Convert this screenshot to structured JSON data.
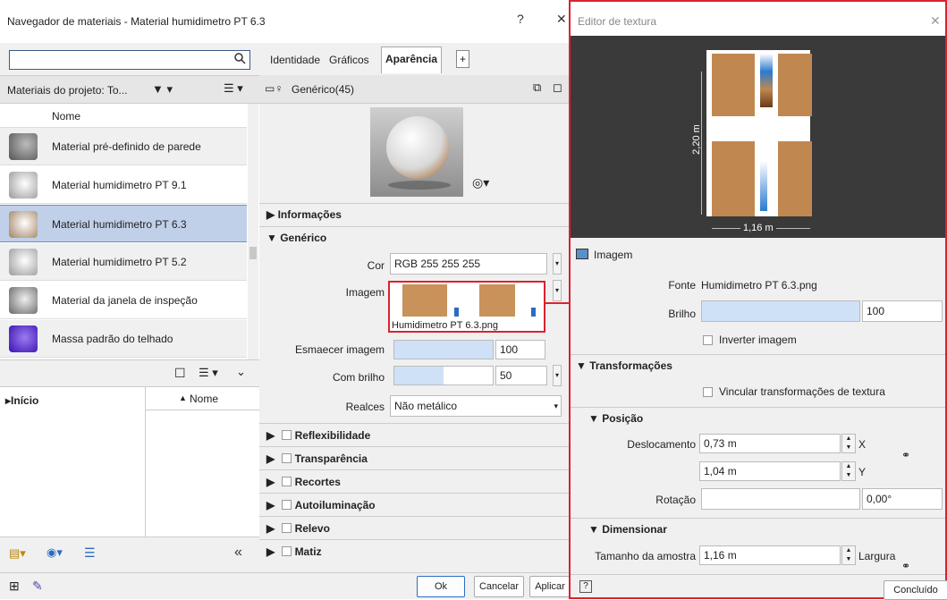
{
  "browser": {
    "title": "Navegador de materiais - Material humidimetro PT 6.3",
    "help": "?",
    "close": "✕",
    "search": {
      "value": "",
      "placeholder": ""
    },
    "filter_label": "Materiais do projeto: To...",
    "column_header": "Nome",
    "materials": [
      {
        "label": "Material pré-definido de parede"
      },
      {
        "label": "Material humidimetro PT 9.1"
      },
      {
        "label": "Material humidimetro PT 6.3"
      },
      {
        "label": "Material humidimetro PT 5.2"
      },
      {
        "label": "Material da janela de inspeção"
      },
      {
        "label": "Massa padrão do telhado"
      }
    ],
    "tree_root": "▸Início",
    "tree_column": "Nome",
    "collapse": "«"
  },
  "tabs": [
    "Identidade",
    "Gráficos",
    "Aparência",
    "+"
  ],
  "asset": {
    "name": "Genérico(45)"
  },
  "sections": {
    "informacoes": "Informações",
    "generico": "Genérico",
    "reflexibilidade": "Reflexibilidade",
    "transparencia": "Transparência",
    "recortes": "Recortes",
    "autoiluminacao": "Autoiluminação",
    "relevo": "Relevo",
    "matiz": "Matiz"
  },
  "generic": {
    "cor_label": "Cor",
    "cor_value": "RGB 255 255 255",
    "imagem_label": "Imagem",
    "imagem_file": "Humidimetro PT 6.3.png",
    "esmaecer_label": "Esmaecer imagem",
    "esmaecer_value": "100",
    "esmaecer_level": 1.0,
    "brilho_label": "Com brilho",
    "brilho_value": "50",
    "brilho_level": 0.5,
    "realces_label": "Realces",
    "realces_value": "Não metálico"
  },
  "buttons": {
    "ok": "Ok",
    "cancel": "Cancelar",
    "apply": "Aplicar"
  },
  "editor": {
    "title": "Editor de textura",
    "close": "✕",
    "dim_height": "2,20 m",
    "dim_width": "1,16 m",
    "imagem_header": "Imagem",
    "fonte_label": "Fonte",
    "fonte_value": "Humidimetro PT 6.3.png",
    "brilho_label": "Brilho",
    "brilho_value": "100",
    "brilho_level": 1.0,
    "inverter_label": "Inverter imagem",
    "transformacoes": "Transformações",
    "vincular_label": "Vincular transformações de textura",
    "posicao": "Posição",
    "deslocamento_label": "Deslocamento",
    "desloc_x": "0,73 m",
    "desloc_y": "1,04 m",
    "x_axis": "X",
    "y_axis": "Y",
    "rotacao_label": "Rotação",
    "rotacao_value": "0,00°",
    "rotacao_level": 0.0,
    "dimensionar": "Dimensionar",
    "tamanho_label": "Tamanho da amostra",
    "tamanho_value": "1,16 m",
    "largura_label": "Largura",
    "help": "?",
    "done": "Concluído"
  }
}
